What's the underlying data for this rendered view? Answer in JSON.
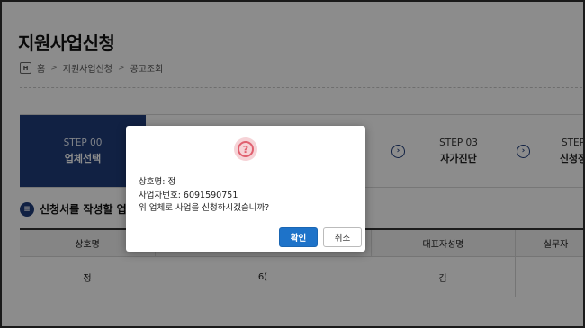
{
  "page": {
    "title": "지원사업신청"
  },
  "breadcrumb": {
    "home_icon_text": "H",
    "items": [
      "홈",
      "지원사업신청",
      "공고조회"
    ],
    "separator": ">"
  },
  "steps": [
    {
      "num": "STEP 00",
      "label": "업체선택",
      "active": true
    },
    {
      "num": "STEP 03",
      "label": "자가진단",
      "active": false
    },
    {
      "num": "STEP",
      "label": "신청정",
      "active": false
    }
  ],
  "step_chevron": "›",
  "section": {
    "icon_text": "≡",
    "title": "신청서를 작성할 업"
  },
  "table": {
    "headers": [
      "상호명",
      "",
      "대표자성명",
      "실무자"
    ],
    "rows": [
      [
        "정",
        "6(",
        "김",
        ""
      ]
    ]
  },
  "modal": {
    "icon": "?",
    "icon_name": "question-icon",
    "line1": "상호명: 정",
    "line2": "사업자번호: 6091590751",
    "line3": "위 업체로 사업을 신청하시겠습니까?",
    "confirm_label": "확인",
    "cancel_label": "취소"
  },
  "colors": {
    "accent": "#1f3d7a",
    "confirm": "#1e73c9",
    "alert": "#e0606f"
  }
}
